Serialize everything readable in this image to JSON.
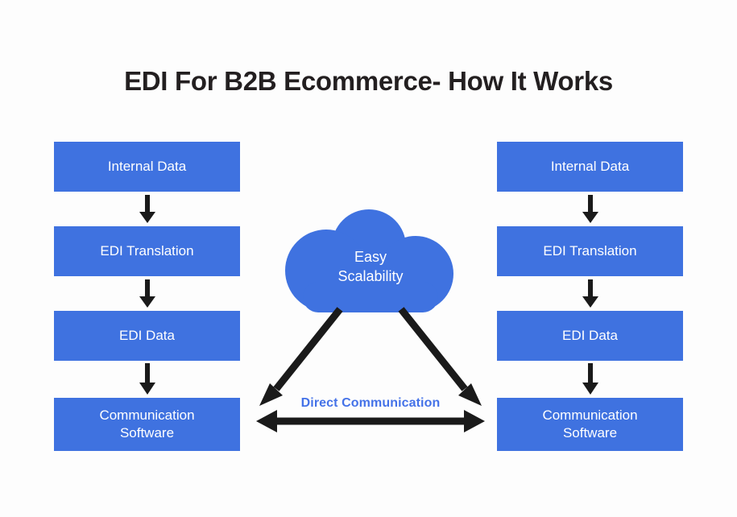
{
  "page": {
    "title": "EDI For B2B Ecommerce- How It Works",
    "background_color": "#fdfdfd"
  },
  "colors": {
    "box_blue": "#3f72e0",
    "cloud_blue": "#3f72e0",
    "box_text": "#ffffff",
    "title_text": "#231f20",
    "arrow_black": "#1a1a1a",
    "direct_label_blue": "#4472e8"
  },
  "left_flow": {
    "name": "left-partner-flow",
    "steps": [
      {
        "label": "Internal Data"
      },
      {
        "label": "EDI Translation"
      },
      {
        "label": "EDI Data"
      },
      {
        "label": "Communication Software",
        "line1": "Communication",
        "line2": "Software"
      }
    ],
    "connector_icon": "down-arrow-icon"
  },
  "right_flow": {
    "name": "right-partner-flow",
    "steps": [
      {
        "label": "Internal Data"
      },
      {
        "label": "EDI Translation"
      },
      {
        "label": "EDI Data"
      },
      {
        "label": "Communication Software",
        "line1": "Communication",
        "line2": "Software"
      }
    ],
    "connector_icon": "down-arrow-icon"
  },
  "cloud": {
    "icon": "cloud-icon",
    "label": "Easy Scalability",
    "line1": "Easy",
    "line2": "Scalability"
  },
  "center_connection": {
    "label": "Direct Communication",
    "left_arrow_icon": "diagonal-arrow-down-left-icon",
    "right_arrow_icon": "diagonal-arrow-down-right-icon",
    "bidirectional_arrow_icon": "double-headed-horizontal-arrow-icon"
  }
}
